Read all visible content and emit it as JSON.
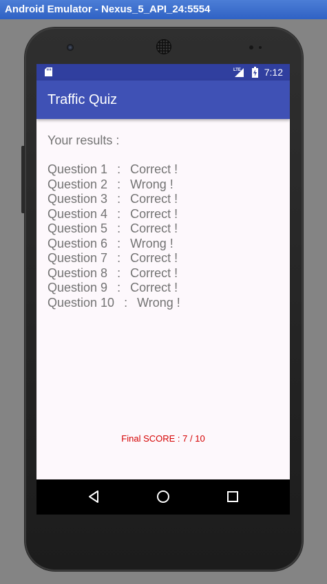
{
  "window": {
    "title": "Android Emulator - Nexus_5_API_24:5554"
  },
  "statusbar": {
    "time": "7:12",
    "icons": [
      "sd-card-icon",
      "lte-signal-icon",
      "battery-charging-icon"
    ],
    "lte_label": "LTE"
  },
  "appbar": {
    "title": "Traffic Quiz"
  },
  "results": {
    "heading": "Your results :",
    "items": [
      {
        "question": "Question 1",
        "result": "Correct !"
      },
      {
        "question": "Question 2",
        "result": "Wrong !"
      },
      {
        "question": "Question 3",
        "result": "Correct !"
      },
      {
        "question": "Question 4",
        "result": "Correct !"
      },
      {
        "question": "Question 5",
        "result": "Correct !"
      },
      {
        "question": "Question 6",
        "result": "Wrong !"
      },
      {
        "question": "Question 7",
        "result": "Correct !"
      },
      {
        "question": "Question 8",
        "result": "Correct !"
      },
      {
        "question": "Question 9",
        "result": "Correct !"
      },
      {
        "question": "Question 10",
        "result": "Wrong !"
      }
    ],
    "separator": " : "
  },
  "final_score": {
    "text": "Final SCORE : 7 / 10",
    "color": "#d50000"
  },
  "navbar": {
    "icons": [
      "back-icon",
      "home-icon",
      "recents-icon"
    ]
  },
  "colors": {
    "primary": "#3f51b5",
    "primary_dark": "#303f9f"
  }
}
